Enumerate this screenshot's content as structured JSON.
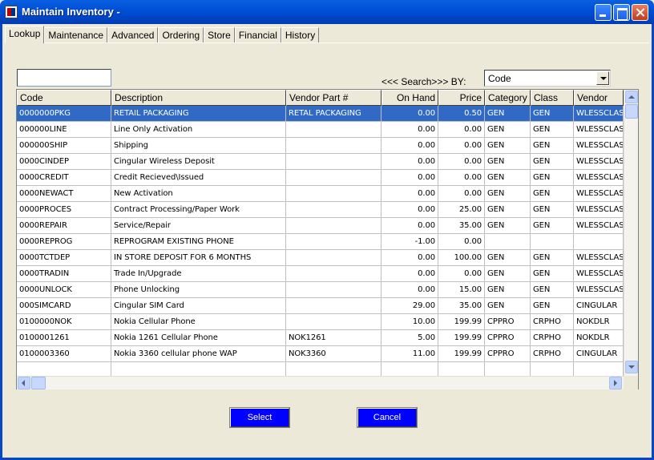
{
  "window": {
    "title": "Maintain Inventory -"
  },
  "tabs": [
    {
      "label": "Lookup",
      "active": true
    },
    {
      "label": "Maintenance"
    },
    {
      "label": "Advanced"
    },
    {
      "label": "Ordering"
    },
    {
      "label": "Store"
    },
    {
      "label": "Financial"
    },
    {
      "label": "History"
    }
  ],
  "search": {
    "value": "",
    "label": "<<< Search>>> BY:",
    "by_selected": "Code"
  },
  "grid": {
    "columns": [
      "Code",
      "Description",
      "Vendor Part #",
      "On Hand",
      "Price",
      "Category",
      "Class",
      "Vendor"
    ],
    "rows": [
      [
        "0000000PKG",
        "RETAIL PACKAGING",
        "RETAL PACKAGING",
        "0.00",
        "0.50",
        "GEN",
        "GEN",
        "WLESSCLAS"
      ],
      [
        "000000LINE",
        "Line Only Activation",
        "",
        "0.00",
        "0.00",
        "GEN",
        "GEN",
        "WLESSCLAS"
      ],
      [
        "000000SHIP",
        "Shipping",
        "",
        "0.00",
        "0.00",
        "GEN",
        "GEN",
        "WLESSCLAS"
      ],
      [
        "0000CINDEP",
        "Cingular Wireless Deposit",
        "",
        "0.00",
        "0.00",
        "GEN",
        "GEN",
        "WLESSCLAS"
      ],
      [
        "0000CREDIT",
        "Credit Recieved\\Issued",
        "",
        "0.00",
        "0.00",
        "GEN",
        "GEN",
        "WLESSCLAS"
      ],
      [
        "0000NEWACT",
        "New Activation",
        "",
        "0.00",
        "0.00",
        "GEN",
        "GEN",
        "WLESSCLAS"
      ],
      [
        "0000PROCES",
        "Contract Processing/Paper Work",
        "",
        "0.00",
        "25.00",
        "GEN",
        "GEN",
        "WLESSCLAS"
      ],
      [
        "0000REPAIR",
        "Service/Repair",
        "",
        "0.00",
        "35.00",
        "GEN",
        "GEN",
        "WLESSCLAS"
      ],
      [
        "0000REPROG",
        "REPROGRAM EXISTING PHONE",
        "",
        "-1.00",
        "0.00",
        "",
        "",
        ""
      ],
      [
        "0000TCTDEP",
        "IN STORE DEPOSIT FOR 6 MONTHS",
        "",
        "0.00",
        "100.00",
        "GEN",
        "GEN",
        "WLESSCLAS"
      ],
      [
        "0000TRADIN",
        "Trade In/Upgrade",
        "",
        "0.00",
        "0.00",
        "GEN",
        "GEN",
        "WLESSCLAS"
      ],
      [
        "0000UNLOCK",
        "Phone Unlocking",
        "",
        "0.00",
        "15.00",
        "GEN",
        "GEN",
        "WLESSCLAS"
      ],
      [
        "000SIMCARD",
        "Cingular SIM Card",
        "",
        "29.00",
        "35.00",
        "GEN",
        "GEN",
        "CINGULAR"
      ],
      [
        "0100000NOK",
        "Nokia Cellular Phone",
        "",
        "10.00",
        "199.99",
        "CPPRO",
        "CRPHO",
        "NOKDLR"
      ],
      [
        "0100001261",
        "Nokia 1261 Cellular Phone",
        "NOK1261",
        "5.00",
        "199.99",
        "CPPRO",
        "CRPHO",
        "NOKDLR"
      ],
      [
        "0100003360",
        "Nokia 3360 cellular phone WAP",
        "NOK3360",
        "11.00",
        "199.99",
        "CPPRO",
        "CRPHO",
        "CINGULAR"
      ],
      [
        "",
        "",
        "",
        "",
        "",
        "",
        "",
        ""
      ]
    ],
    "selected_row": 0
  },
  "buttons": {
    "select": "Select",
    "cancel": "Cancel"
  },
  "colors": {
    "title_bar": "#0050d8",
    "selection": "#316ac5",
    "button_blue": "#0000ff"
  }
}
